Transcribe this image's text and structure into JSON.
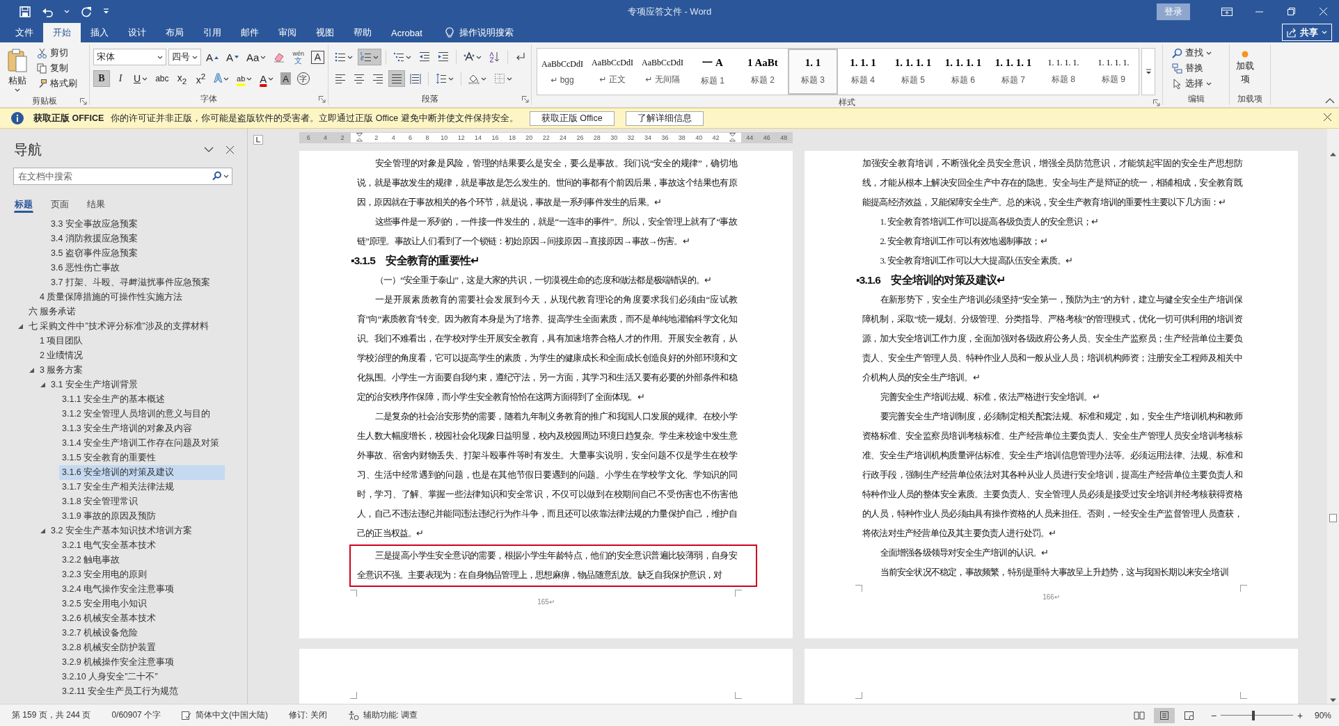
{
  "window": {
    "title": "专项应答文件  -  Word",
    "sign_in": "登录"
  },
  "tabs": [
    {
      "label": "文件",
      "selected": false
    },
    {
      "label": "开始",
      "selected": true
    },
    {
      "label": "插入",
      "selected": false
    },
    {
      "label": "设计",
      "selected": false
    },
    {
      "label": "布局",
      "selected": false
    },
    {
      "label": "引用",
      "selected": false
    },
    {
      "label": "邮件",
      "selected": false
    },
    {
      "label": "审阅",
      "selected": false
    },
    {
      "label": "视图",
      "selected": false
    },
    {
      "label": "帮助",
      "selected": false
    },
    {
      "label": "Acrobat",
      "selected": false
    }
  ],
  "tell_me": "操作说明搜索",
  "share": "共享",
  "ribbon": {
    "clipboard": {
      "paste": "粘贴",
      "cut": "剪切",
      "copy": "复制",
      "format_painter": "格式刷",
      "label": "剪贴板"
    },
    "font": {
      "face": "宋体",
      "size": "四号",
      "label": "字体",
      "row1": [
        {
          "kind": "grow",
          "label": "A"
        },
        {
          "kind": "shrink",
          "label": "A"
        },
        {
          "kind": "case",
          "label": "Aa"
        },
        {
          "kind": "clear"
        },
        {
          "kind": "phonetic",
          "label": "文",
          "ruby": "wén"
        },
        {
          "kind": "border",
          "label": "A"
        }
      ],
      "row2": [
        {
          "kind": "bold",
          "label": "B",
          "on": true
        },
        {
          "kind": "italic",
          "label": "I",
          "on": false
        },
        {
          "kind": "underline",
          "label": "U",
          "on": false
        },
        {
          "kind": "strike",
          "label": "abc",
          "on": false
        },
        {
          "kind": "subscript",
          "label": "x$_{2}$",
          "on": false
        },
        {
          "kind": "superscript",
          "label": "x$^{2}$",
          "on": false
        },
        {
          "kind": "effects",
          "label": "A",
          "on": false
        },
        {
          "kind": "highlight",
          "label": "ab",
          "on": false
        },
        {
          "kind": "color",
          "label": "A",
          "on": false
        },
        {
          "kind": "shading",
          "label": "A",
          "on": false
        },
        {
          "kind": "enclose",
          "label": "字",
          "on": false
        }
      ]
    },
    "paragraph": {
      "label": "段落",
      "row1": [
        {
          "kind": "bullets",
          "on": false
        },
        {
          "kind": "numbering",
          "on": true
        },
        {
          "kind": "multilevel",
          "on": false
        },
        {
          "kind": "outdent",
          "on": false
        },
        {
          "kind": "indent",
          "on": false
        },
        {
          "kind": "asian",
          "on": false
        },
        {
          "kind": "sort",
          "on": false
        },
        {
          "kind": "marks",
          "on": false
        }
      ],
      "row2": [
        {
          "kind": "left",
          "on": false
        },
        {
          "kind": "center",
          "on": false
        },
        {
          "kind": "right",
          "on": false
        },
        {
          "kind": "justify",
          "on": true
        },
        {
          "kind": "distributed",
          "on": false
        },
        {
          "kind": "spacing",
          "on": false
        },
        {
          "kind": "shading",
          "on": false
        },
        {
          "kind": "borders",
          "on": false
        }
      ]
    },
    "styles": {
      "label": "样式",
      "items": [
        {
          "preview": "AaBbCcDdI",
          "name": "↵ bgg",
          "kind": "plain",
          "selected": false
        },
        {
          "preview": "AaBbCcDdI",
          "name": "↵ 正文",
          "kind": "plain",
          "selected": false
        },
        {
          "preview": "AaBbCcDdI",
          "name": "↵ 无间隔",
          "kind": "plain",
          "selected": false
        },
        {
          "preview": "一  A",
          "name": "标题 1",
          "kind": "heading",
          "selected": false
        },
        {
          "preview": "1  AaBt",
          "name": "标题 2",
          "kind": "heading",
          "selected": false
        },
        {
          "preview": "1. 1",
          "name": "标题 3",
          "kind": "heading",
          "selected": true
        },
        {
          "preview": "1. 1. 1",
          "name": "标题 4",
          "kind": "heading",
          "selected": false
        },
        {
          "preview": "1. 1. 1. 1",
          "name": "标题 5",
          "kind": "heading",
          "selected": false
        },
        {
          "preview": "1. 1. 1. 1",
          "name": "标题 6",
          "kind": "heading",
          "selected": false
        },
        {
          "preview": "1. 1. 1. 1",
          "name": "标题 7",
          "kind": "heading",
          "selected": false
        },
        {
          "preview": "1. 1. 1. 1.",
          "name": "标题 8",
          "kind": "plain",
          "selected": false
        },
        {
          "preview": "1. 1. 1. 1.",
          "name": "标题 9",
          "kind": "plain",
          "selected": false
        }
      ]
    },
    "editing": {
      "label": "编辑",
      "find": "查找",
      "replace": "替换",
      "select": "选择"
    },
    "addins": {
      "button": "加载项",
      "label": "加载项"
    }
  },
  "notice": {
    "title": "获取正版 OFFICE",
    "message": "你的许可证并非正版，你可能是盗版软件的受害者。立即通过正版 Office 避免中断并使文件保持安全。",
    "buttons": [
      "获取正版 Office",
      "了解详细信息"
    ]
  },
  "navigation": {
    "title": "导航",
    "search": {
      "placeholder": "在文档中搜索"
    },
    "tabs": [
      {
        "label": "标题",
        "selected": true
      },
      {
        "label": "页面",
        "selected": false
      },
      {
        "label": "结果",
        "selected": false
      }
    ],
    "outline": [
      {
        "children": [
          {
            "children": [
              {
                "label": "3.3 安全事故应急预案",
                "selected": false
              },
              {
                "label": "3.4 消防救援应急预案",
                "selected": false
              },
              {
                "label": "3.5 盗窃事件应急预案",
                "selected": false
              },
              {
                "label": "3.6 恶性伤亡事故",
                "selected": false
              },
              {
                "label": "3.7 打架、斗殴、寻衅滋扰事件应急预案",
                "selected": false
              }
            ]
          },
          {
            "label": "4 质量保障措施的可操作性实施方法",
            "selected": false
          }
        ]
      },
      {
        "label": "六 服务承诺",
        "selected": false
      },
      {
        "label": "七 采购文件中”技术评分标准”涉及的支撑材料",
        "selected": false,
        "expanded": true,
        "children": [
          {
            "label": "1 项目团队",
            "selected": false
          },
          {
            "label": "2 业绩情况",
            "selected": false
          },
          {
            "label": "3 服务方案",
            "selected": false,
            "expanded": true,
            "children": [
              {
                "label": "3.1 安全生产培训背景",
                "selected": false,
                "expanded": true,
                "children": [
                  {
                    "label": "3.1.1 安全生产的基本概述",
                    "selected": false
                  },
                  {
                    "label": "3.1.2 安全管理人员培训的意义与目的",
                    "selected": false
                  },
                  {
                    "label": "3.1.3 安全生产培训的对象及内容",
                    "selected": false
                  },
                  {
                    "label": "3.1.4 安全生产培训工作存在问题及对策",
                    "selected": false
                  },
                  {
                    "label": "3.1.5 安全教育的重要性",
                    "selected": false
                  },
                  {
                    "label": "3.1.6 安全培训的对策及建议",
                    "selected": true
                  },
                  {
                    "label": "3.1.7 安全生产相关法律法规",
                    "selected": false
                  },
                  {
                    "label": "3.1.8 安全管理常识",
                    "selected": false
                  },
                  {
                    "label": "3.1.9 事故的原因及预防",
                    "selected": false
                  }
                ]
              },
              {
                "label": "3.2 安全生产基本知识技术培训方案",
                "selected": false,
                "expanded": true,
                "children": [
                  {
                    "label": "3.2.1  电气安全基本技术",
                    "selected": false
                  },
                  {
                    "label": "3.2.2 触电事故",
                    "selected": false
                  },
                  {
                    "label": "3.2.3 安全用电的原则",
                    "selected": false
                  },
                  {
                    "label": "3.2.4 电气操作安全注意事项",
                    "selected": false
                  },
                  {
                    "label": "3.2.5 安全用电小知识",
                    "selected": false
                  },
                  {
                    "label": "3.2.6  机械安全基本技术",
                    "selected": false
                  },
                  {
                    "label": "3.2.7 机械设备危险",
                    "selected": false
                  },
                  {
                    "label": "3.2.8 机械安全防护装置",
                    "selected": false
                  },
                  {
                    "label": "3.2.9 机械操作安全注意事项",
                    "selected": false
                  },
                  {
                    "label": "3.2.10 人身安全”二十不”",
                    "selected": false
                  },
                  {
                    "label": "3.2.11 安全生产员工行为规范",
                    "selected": false
                  }
                ]
              }
            ]
          }
        ]
      }
    ]
  },
  "ruler": [
    {
      "kind": "number",
      "label": "6"
    },
    {
      "kind": "number",
      "label": "4"
    },
    {
      "kind": "number",
      "label": "2"
    },
    {
      "kind": "marker"
    },
    {
      "kind": "number",
      "label": "2"
    },
    {
      "kind": "number",
      "label": "4"
    },
    {
      "kind": "number",
      "label": "6"
    },
    {
      "kind": "number",
      "label": "8"
    },
    {
      "kind": "number",
      "label": "10"
    },
    {
      "kind": "number",
      "label": "12"
    },
    {
      "kind": "number",
      "label": "14"
    },
    {
      "kind": "number",
      "label": "16"
    },
    {
      "kind": "number",
      "label": "18"
    },
    {
      "kind": "number",
      "label": "20"
    },
    {
      "kind": "number",
      "label": "22"
    },
    {
      "kind": "number",
      "label": "24"
    },
    {
      "kind": "number",
      "label": "26"
    },
    {
      "kind": "number",
      "label": "28"
    },
    {
      "kind": "number",
      "label": "30"
    },
    {
      "kind": "number",
      "label": "32"
    },
    {
      "kind": "number",
      "label": "34"
    },
    {
      "kind": "number",
      "label": "36"
    },
    {
      "kind": "number",
      "label": "38"
    },
    {
      "kind": "number",
      "label": "40"
    },
    {
      "kind": "number",
      "label": "42"
    },
    {
      "kind": "marker"
    },
    {
      "kind": "number",
      "label": "44"
    },
    {
      "kind": "number",
      "label": "46"
    },
    {
      "kind": "number",
      "label": "48"
    }
  ],
  "pages": [
    {
      "number": "165↵",
      "paragraphs": [
        {
          "kind": "body",
          "text": "安全管理的对象是风险，管理的结果要么是安全，要么是事故。我们说“安全的规律”，确切地说，就是事故发生的规律，就是事故是怎么发生的。世间的事都有个前因后果，事故这个结果也有原因，原因就在于事故相关的各个环节，就是说，事故是一系列事件发生的后果。↵"
        },
        {
          "kind": "body",
          "text": "这些事件是一系列的，一件接一件发生的，就是“一连串的事件”。所以，安全管理上就有了“事故链”原理。事故让人们看到了一个锁链：初始原因→间接原因→直接原因→事故→伤害。↵"
        },
        {
          "kind": "heading",
          "text": "▪3.1.5　安全教育的重要性↵"
        },
        {
          "kind": "body",
          "text": "（一）“安全重于泰山”，这是大家的共识，一切漠视生命的态度和做法都是极端错误的。↵"
        },
        {
          "kind": "body",
          "text": "一是开展素质教育的需要社会发展到今天，从现代教育理论的角度要求我们必须由“应试教育”向“素质教育”转变。因为教育本身是为了培养、提高学生全面素质，而不是单纯地灌输科学文化知识。我们不难看出，在学校对学生开展安全教育，具有加速培养合格人才的作用。开展安全教育，从学校治理的角度看，它可以提高学生的素质，为学生的健康成长和全面成长创造良好的外部环境和文化氛围。小学生一方面要自我约束，遵纪守法，另一方面，其学习和生活又要有必要的外部条件和稳定的治安秩序作保障，而小学生安全教育恰恰在这两方面得到了全面体现。↵"
        },
        {
          "kind": "body",
          "text": "二是复杂的社会治安形势的需要，随着九年制义务教育的推广和我国人口发展的规律。在校小学生人数大幅度增长，校园社会化现象日益明显，校内及校园周边环境日趋复杂。学生来校途中发生意外事故、宿舍内财物丢失、打架斗殴事件等时有发生。大量事实说明，安全问题不仅是学生在校学习、生活中经常遇到的问题，也是在其他节假日要遇到的问题。小学生在学校学文化、学知识的同时，学习、了解、掌握一些法律知识和安全常识，不仅可以做到在校期间自己不受伤害也不伤害他人，自己不违法违纪并能同违法违纪行为作斗争，而且还可以依靠法律法规的力量保护自己，维护自己的正当权益。↵"
        },
        {
          "kind": "body",
          "highlighted": true,
          "text": "三是提高小学生安全意识的需要，根据小学生年龄特点，他们的安全意识普遍比较薄弱，自身安全意识不强。主要表现为：在自身物品管理上，思想麻痹，物品随意乱放。缺乏自我保护意识，对"
        }
      ]
    },
    {
      "number": "166↵",
      "paragraphs": [
        {
          "kind": "continuation",
          "text": "加强安全教育培训，不断强化全员安全意识，增强全员防范意识，才能筑起牢固的安全生产思想防线，才能从根本上解决安回全生产中存在的隐患。安全与生产是辩证的统一，相辅相成，安全教育既能提高经济效益，又能保障安全生产。总的来说，安全生产教育培训的重要性主要以下几方面：↵"
        },
        {
          "kind": "body",
          "text": "1. 安全教育答培训工作可以提高各级负责人的安全意识；↵"
        },
        {
          "kind": "body",
          "text": "2. 安全教育培训工作可以有效地遏制事故；↵"
        },
        {
          "kind": "body",
          "text": "3. 安全教育培训工作可以大大提高队伍安全素质。↵"
        },
        {
          "kind": "heading",
          "text": "▪3.1.6　安全培训的对策及建议↵"
        },
        {
          "kind": "body",
          "text": "在新形势下，安全生产培训必须坚持“安全第一，预防为主”的方针，建立与健全安全生产培训保障机制，采取“统一规划、分级管理、分类指导、严格考核”的管理模式，优化一切可供利用的培训资源，加大安全培训工作力度，全面加强对各级政府公务人员、安全生产监察员；生产经营单位主要负责人、安全生产管理人员、特种作业人员和一般从业人员；培训机构师资；注册安全工程师及相关中介机构人员的安全生产培训。↵"
        },
        {
          "kind": "body",
          "text": "完善安全生产培训法规、标准，依法严格进行安全培训。↵"
        },
        {
          "kind": "body",
          "text": "要完善安全生产培训制度，必须制定相关配套法规、标准和规定，如，安全生产培训机构和教师资格标准、安全监察员培训考核标准、生产经营单位主要负责人、安全生产管理人员安全培训考核标准、安全生产培训机构质量评估标准、安全生产培训信息管理办法等。必须运用法律、法规、标准和行政手段，强制生产经营单位依法对其各种从业人员进行安全培训，提高生产经营单位主要负责人和特种作业人员的整体安全素质。主要负责人、安全管理人员必须是接受过安全培训并经考核获得资格的人员，特种作业人员必须由具有操作资格的人员来担任。否则，一经安全生产监督管理人员查获，将依法对生产经营单位及其主要负责人进行处罚。↵"
        },
        {
          "kind": "body",
          "text": "全面增强各级领导对安全生产培训的认识。↵"
        },
        {
          "kind": "body",
          "text": "当前安全状况不稳定，事故频繁，特别是重特大事故呈上升趋势，这与我国长期以来安全培训"
        }
      ]
    }
  ],
  "status_bar": {
    "page": "第 159 页，共 244 页",
    "words": "0/60907 个字",
    "language": "简体中文(中国大陆)",
    "track_changes": "修订: 关闭",
    "accessibility": "辅助功能: 调查",
    "views": [
      {
        "kind": "read",
        "selected": false
      },
      {
        "kind": "print",
        "selected": true
      },
      {
        "kind": "web",
        "selected": false
      }
    ],
    "zoom": {
      "out": "−",
      "in": "+",
      "level": 0.45,
      "reading": "90%"
    }
  }
}
